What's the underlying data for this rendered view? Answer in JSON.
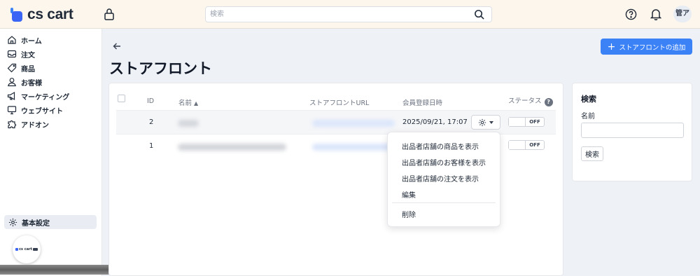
{
  "header": {
    "logo_text": "cs cart",
    "search_placeholder": "検索",
    "avatar_text": "管ア"
  },
  "sidebar": {
    "items": [
      {
        "label": "ホーム",
        "icon": "home-icon"
      },
      {
        "label": "注文",
        "icon": "inbox-icon"
      },
      {
        "label": "商品",
        "icon": "tag-icon"
      },
      {
        "label": "お客様",
        "icon": "user-icon"
      },
      {
        "label": "マーケティング",
        "icon": "megaphone-icon"
      },
      {
        "label": "ウェブサイト",
        "icon": "monitor-icon"
      },
      {
        "label": "アドオン",
        "icon": "puzzle-icon"
      }
    ],
    "settings_label": "基本設定",
    "badge_text": "cs cart"
  },
  "main": {
    "title": "ストアフロント",
    "add_button_label": "ストアフロントの追加",
    "table": {
      "headers": {
        "id": "ID",
        "name": "名前",
        "url": "ストアフロントURL",
        "registered": "会員登録日時",
        "status": "ステータス"
      },
      "rows": [
        {
          "id": "2",
          "date": "2025/09/21, 17:07",
          "status": "OFF"
        },
        {
          "id": "1",
          "date": "",
          "status": "OFF"
        }
      ]
    },
    "dropdown": {
      "items": [
        "出品者店舗の商品を表示",
        "出品者店舗のお客様を表示",
        "出品者店舗の注文を表示",
        "編集",
        "削除"
      ]
    }
  },
  "search_panel": {
    "title": "検索",
    "name_label": "名前",
    "name_value": "",
    "button_label": "検索"
  },
  "colors": {
    "accent": "#3b82f6",
    "topbar_bg": "#fdf6ec",
    "page_bg": "#eef1f5"
  }
}
